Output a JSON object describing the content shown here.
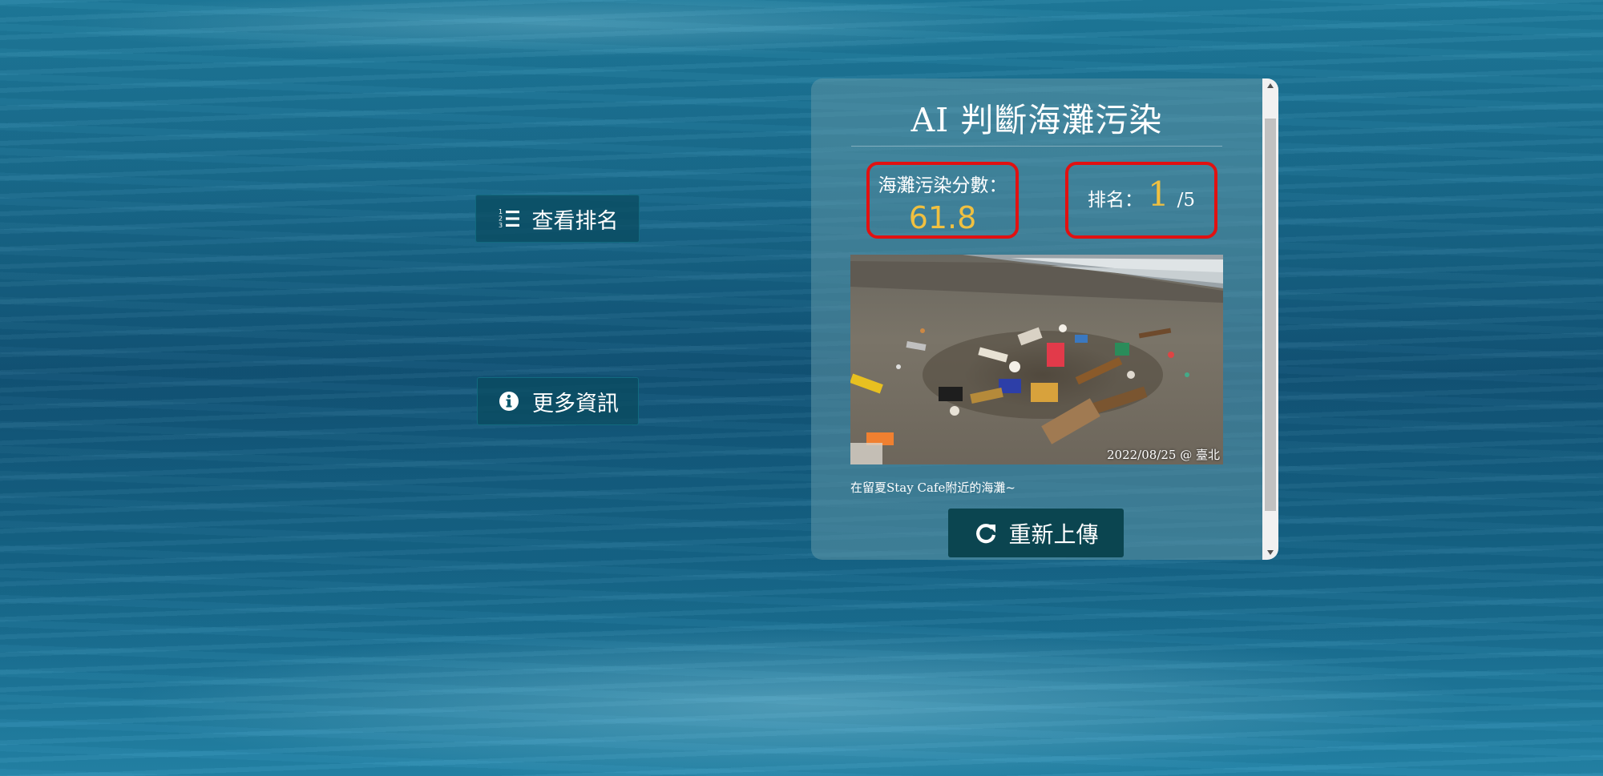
{
  "side_buttons": {
    "ranking_label": "查看排名",
    "ranking_icon": "list-ol-icon",
    "info_label": "更多資訊",
    "info_icon": "info-circle-icon"
  },
  "card": {
    "title": "AI 判斷海灘污染",
    "score": {
      "label": "海灘污染分數：",
      "value": "61.8"
    },
    "rank": {
      "label": "排名：",
      "value": "1",
      "total": "/5"
    },
    "photo": {
      "caption": "2022/08/25 @ 臺北",
      "subject": "beach-trash-photo"
    },
    "description": "在留夏Stay Cafe附近的海灘~",
    "reupload": {
      "label": "重新上傳",
      "icon": "refresh-icon"
    }
  },
  "colors": {
    "accent_value": "#f0c040",
    "highlight_border": "#e11111",
    "button_dark": "#0b4550"
  }
}
